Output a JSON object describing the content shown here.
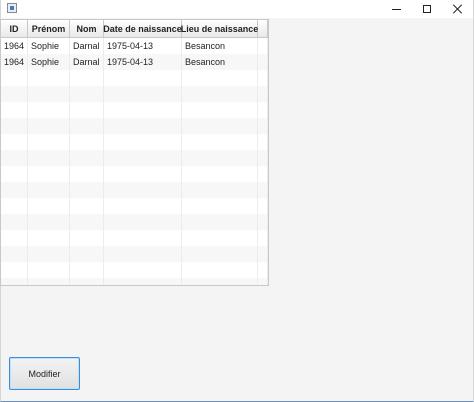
{
  "window": {
    "controls": {
      "minimize": "minimize-icon",
      "maximize": "maximize-icon",
      "close": "close-icon"
    }
  },
  "table": {
    "columns": [
      "ID",
      "Prénom",
      "Nom",
      "Date de naissance",
      "Lieu de naissance",
      ""
    ],
    "rows": [
      [
        "1964",
        "Sophie",
        "Darnal",
        "1975-04-13",
        "Besancon",
        ""
      ],
      [
        "1964",
        "Sophie",
        "Darnal",
        "1975-04-13",
        "Besancon",
        ""
      ],
      [
        "",
        "",
        "",
        "",
        "",
        ""
      ],
      [
        "",
        "",
        "",
        "",
        "",
        ""
      ],
      [
        "",
        "",
        "",
        "",
        "",
        ""
      ],
      [
        "",
        "",
        "",
        "",
        "",
        ""
      ],
      [
        "",
        "",
        "",
        "",
        "",
        ""
      ],
      [
        "",
        "",
        "",
        "",
        "",
        ""
      ],
      [
        "",
        "",
        "",
        "",
        "",
        ""
      ],
      [
        "",
        "",
        "",
        "",
        "",
        ""
      ],
      [
        "",
        "",
        "",
        "",
        "",
        ""
      ],
      [
        "",
        "",
        "",
        "",
        "",
        ""
      ],
      [
        "",
        "",
        "",
        "",
        "",
        ""
      ],
      [
        "",
        "",
        "",
        "",
        "",
        ""
      ],
      [
        "",
        "",
        "",
        "",
        "",
        ""
      ],
      [
        "",
        "",
        "",
        "",
        "",
        ""
      ]
    ]
  },
  "actions": {
    "modify_label": "Modifier"
  }
}
